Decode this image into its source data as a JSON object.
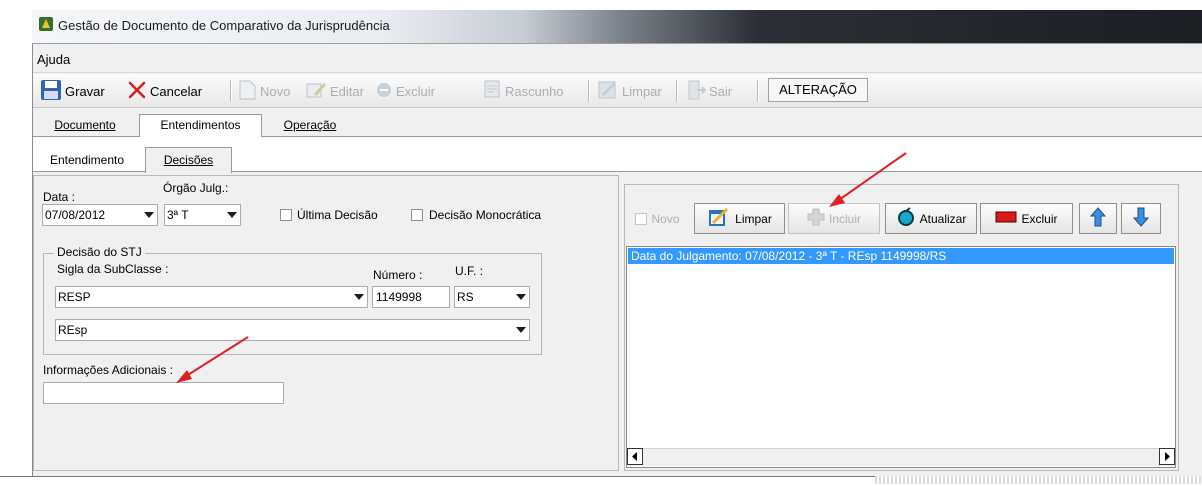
{
  "window": {
    "title": "Gestão de Documento de Comparativo da Jurisprudência",
    "menu": [
      "Ajuda"
    ]
  },
  "toolbar": {
    "buttons": [
      {
        "label": "Gravar",
        "icon": "save-icon",
        "enabled": true
      },
      {
        "label": "Cancelar",
        "icon": "cancel-x-icon",
        "enabled": true
      },
      {
        "label": "Novo",
        "icon": "new-document-icon",
        "enabled": false
      },
      {
        "label": "Editar",
        "icon": "edit-icon",
        "enabled": false
      },
      {
        "label": "Excluir",
        "icon": "delete-icon",
        "enabled": false
      },
      {
        "label": "Rascunho",
        "icon": "draft-icon",
        "enabled": false
      },
      {
        "label": "Limpar",
        "icon": "clear-icon",
        "enabled": false
      },
      {
        "label": "Sair",
        "icon": "exit-icon",
        "enabled": false
      }
    ],
    "mode": "ALTERAÇÃO"
  },
  "tabs_main": [
    "Documento",
    "Entendimentos",
    "Operação"
  ],
  "tabs_main_active": "Entendimentos",
  "tabs_sub": [
    "Entendimento",
    "Decisões"
  ],
  "tabs_sub_active": "Decisões",
  "form": {
    "data_label": "Data :",
    "data_value": "07/08/2012",
    "orgao_label": "Órgão Julg.:",
    "orgao_value": "3ª T",
    "ultima_decisao_label": "Última Decisão",
    "ultima_decisao_checked": false,
    "decisao_monocratica_label": "Decisão Monocrática",
    "decisao_monocratica_checked": false,
    "group_stj_label": "Decisão do STJ",
    "sigla_label": "Sigla da SubClasse :",
    "sigla_value": "RESP",
    "numero_label": "Número :",
    "numero_value": "1149998",
    "uf_label": "U.F. :",
    "uf_value": "RS",
    "classe_value": "REsp",
    "info_label": "Informações Adicionais :",
    "info_value": ""
  },
  "right_panel": {
    "buttons": [
      {
        "label": "Novo",
        "enabled": false,
        "icon": "checkbox-icon"
      },
      {
        "label": "Limpar",
        "enabled": true,
        "icon": "clear-icon"
      },
      {
        "label": "Incluir",
        "enabled": false,
        "icon": "plus-icon"
      },
      {
        "label": "Atualizar",
        "enabled": true,
        "icon": "refresh-icon"
      },
      {
        "label": "Excluir",
        "enabled": true,
        "icon": "delete-bar-icon"
      }
    ],
    "list_items": [
      "Data do Julgamento: 07/08/2012 - 3ª T - REsp 1149998/RS"
    ],
    "selection_color": "#3399ff"
  },
  "annotation_color": "#e02020"
}
